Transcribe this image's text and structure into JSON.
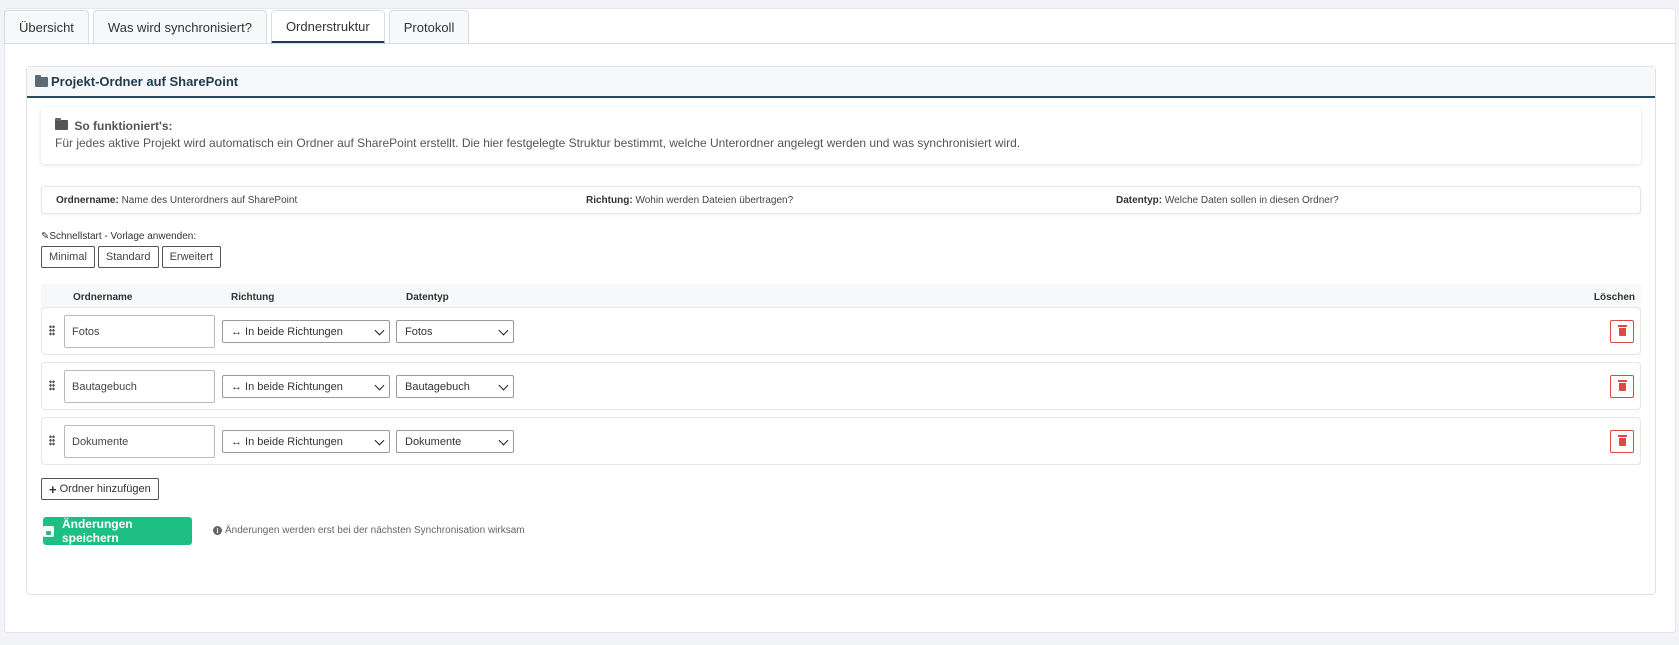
{
  "tabs": [
    {
      "label": "Übersicht"
    },
    {
      "label": "Was wird synchronisiert?"
    },
    {
      "label": "Ordnerstruktur"
    },
    {
      "label": "Protokoll"
    }
  ],
  "active_tab": "Ordnerstruktur",
  "panel": {
    "title": "Projekt-Ordner auf SharePoint",
    "icon": "folder-icon"
  },
  "info": {
    "title": "So funktioniert's:",
    "text": "Für jedes aktive Projekt wird automatisch ein Ordner auf SharePoint erstellt. Die hier festgelegte Struktur bestimmt, welche Unterordner angelegt werden und was synchronisiert wird."
  },
  "legend": [
    {
      "key": "Ordnername:",
      "text": "Name des Unterordners auf SharePoint"
    },
    {
      "key": "Richtung:",
      "text": "Wohin werden Dateien übertragen?"
    },
    {
      "key": "Datentyp:",
      "text": "Welche Daten sollen in diesen Ordner?"
    }
  ],
  "quickstart": {
    "label": "Schnellstart - Vorlage anwenden:",
    "buttons": [
      "Minimal",
      "Standard",
      "Erweitert"
    ]
  },
  "table": {
    "headers": {
      "name": "Ordnername",
      "direction": "Richtung",
      "type": "Datentyp",
      "delete": "Löschen"
    },
    "rows": [
      {
        "name": "Fotos",
        "direction": "↔ In beide Richtungen",
        "type": "Fotos"
      },
      {
        "name": "Bautagebuch",
        "direction": "↔ In beide Richtungen",
        "type": "Bautagebuch"
      },
      {
        "name": "Dokumente",
        "direction": "↔ In beide Richtungen",
        "type": "Dokumente"
      }
    ]
  },
  "add_folder_label": "Ordner hinzufügen",
  "save_label": "Änderungen speichern",
  "save_note": "Änderungen werden erst bei der nächsten Synchronisation wirksam",
  "colors": {
    "accent": "#1dbf85",
    "danger": "#e04848",
    "header_line": "#2b4a5c"
  }
}
